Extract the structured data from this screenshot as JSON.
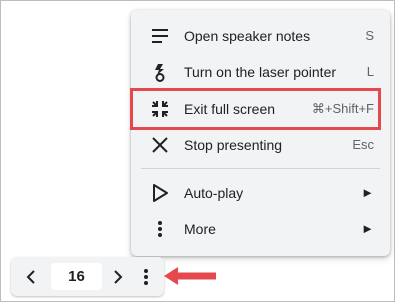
{
  "menu": {
    "items": [
      {
        "label": "Open speaker notes",
        "shortcut": "S",
        "icon": "speaker-notes-icon"
      },
      {
        "label": "Turn on the laser pointer",
        "shortcut": "L",
        "icon": "laser-pointer-icon"
      },
      {
        "label": "Exit full screen",
        "shortcut": "⌘+Shift+F",
        "icon": "exit-fullscreen-icon"
      },
      {
        "label": "Stop presenting",
        "shortcut": "Esc",
        "icon": "close-icon"
      },
      {
        "label": "Auto-play",
        "submenu_arrow": "►",
        "icon": "play-icon"
      },
      {
        "label": "More",
        "submenu_arrow": "►",
        "icon": "more-vert-icon"
      }
    ]
  },
  "pager": {
    "prev_icon": "chevron-left-icon",
    "page_number": "16",
    "next_icon": "chevron-right-icon",
    "options_icon": "more-vert-icon"
  },
  "colors": {
    "highlight": "#e5484d",
    "arrow": "#e5484d",
    "menu_bg": "#f1f3f4",
    "icon": "#202124"
  }
}
